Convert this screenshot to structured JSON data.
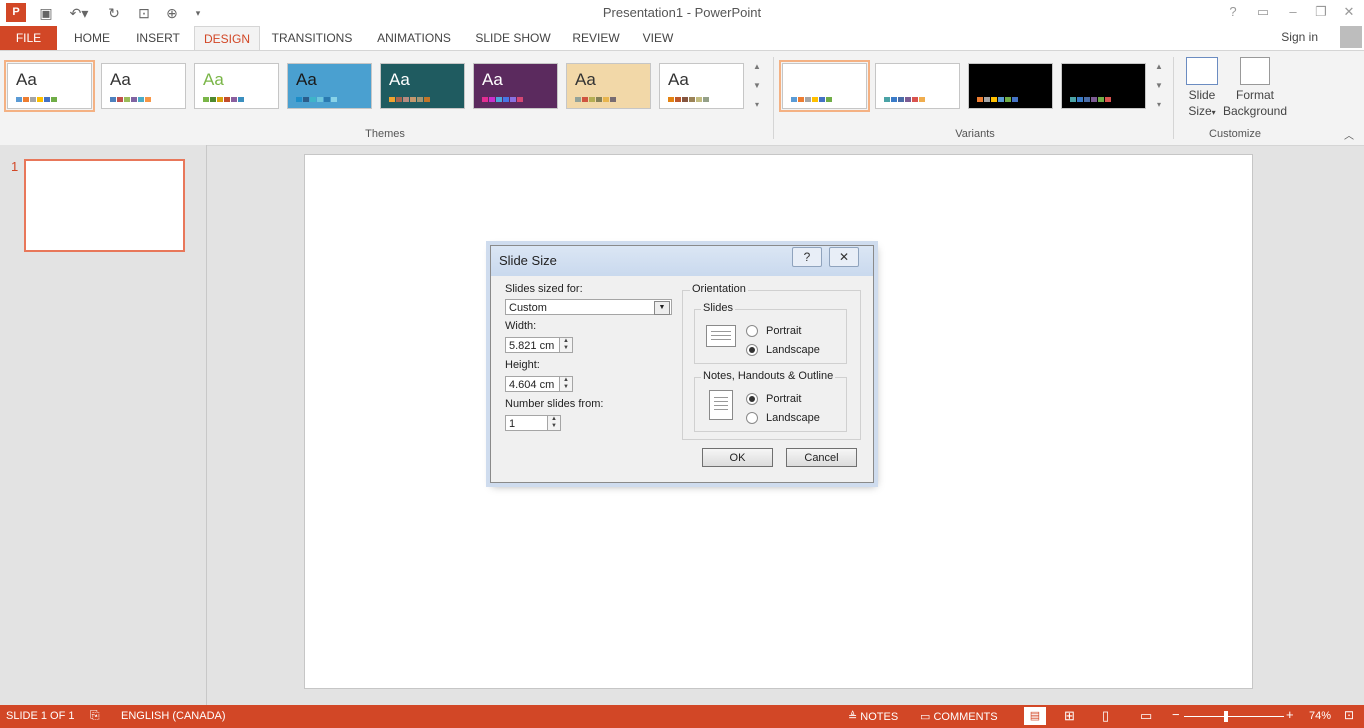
{
  "app": {
    "icon_text": "P",
    "window_title": "Presentation1 - PowerPoint",
    "quick_access": [
      "save-icon",
      "undo-icon",
      "redo-icon",
      "start-from-beginning-icon",
      "print-preview-icon",
      "customize-qat-icon"
    ],
    "window_controls": {
      "help": "?",
      "restore_ribbon": "▭",
      "minimize": "–",
      "maximize": "❐",
      "close": "✕"
    }
  },
  "tabs": [
    {
      "label": "FILE"
    },
    {
      "label": "HOME"
    },
    {
      "label": "INSERT"
    },
    {
      "label": "DESIGN",
      "selected": true
    },
    {
      "label": "TRANSITIONS"
    },
    {
      "label": "ANIMATIONS"
    },
    {
      "label": "SLIDE SHOW"
    },
    {
      "label": "REVIEW"
    },
    {
      "label": "VIEW"
    }
  ],
  "sign_in": "Sign in",
  "ribbon": {
    "themes_label": "Themes",
    "variants_label": "Variants",
    "customize_label": "Customize",
    "themes": [
      {
        "text": "Aa",
        "bg": "#ffffff",
        "text_color": "#333333",
        "swatches": [
          "#5b9bd5",
          "#ed7d31",
          "#a5a5a5",
          "#ffc000",
          "#4472c4",
          "#70ad47"
        ]
      },
      {
        "text": "Aa",
        "bg": "#ffffff",
        "text_color": "#333333",
        "swatches": [
          "#4f81bd",
          "#c0504d",
          "#9bbb59",
          "#8064a2",
          "#4bacc6",
          "#f79646"
        ]
      },
      {
        "text": "Aa",
        "bg": "#ffffff",
        "text_color": "#7ab648",
        "swatches": [
          "#7ab648",
          "#4f8a2e",
          "#d8a20d",
          "#c24d2c",
          "#8a5f9e",
          "#3b8fbf"
        ]
      },
      {
        "text": "Aa",
        "bg": "#4aa0d0",
        "text_color": "#1a1a1a",
        "swatches": [
          "#1d8dc8",
          "#2b5d8a",
          "#3fb4c9",
          "#6dc6dd",
          "#2a7ab0",
          "#88d3e8"
        ]
      },
      {
        "text": "Aa",
        "bg": "#1f5b60",
        "text_color": "#ffffff",
        "swatches": [
          "#f0a22e",
          "#a5644e",
          "#b58b80",
          "#c3986d",
          "#a19574",
          "#c17529"
        ]
      },
      {
        "text": "Aa",
        "bg": "#5b2a5e",
        "text_color": "#ffffff",
        "swatches": [
          "#e32d91",
          "#c830cc",
          "#4ea6dc",
          "#4775e7",
          "#8971e1",
          "#d54773"
        ]
      },
      {
        "text": "Aa",
        "bg": "#f2d8a8",
        "text_color": "#333333",
        "swatches": [
          "#93a299",
          "#cf543f",
          "#b5ae53",
          "#848058",
          "#e8b54d",
          "#786c71"
        ]
      },
      {
        "text": "Aa",
        "bg": "#ffffff",
        "text_color": "#333333",
        "swatches": [
          "#e48312",
          "#bd582c",
          "#865640",
          "#9b8357",
          "#c2bc80",
          "#94a088"
        ]
      }
    ],
    "variants": [
      {
        "bg": "#ffffff",
        "swatches": [
          "#5b9bd5",
          "#ed7d31",
          "#a5a5a5",
          "#ffc000",
          "#4472c4",
          "#70ad47"
        ]
      },
      {
        "bg": "#ffffff",
        "swatches": [
          "#4aa3a6",
          "#3a7bc8",
          "#4a6da7",
          "#7c5c93",
          "#d9534f",
          "#f0ad4e"
        ]
      },
      {
        "bg": "#000000",
        "swatches": [
          "#ed7d31",
          "#a5a5a5",
          "#ffc000",
          "#5b9bd5",
          "#70ad47",
          "#4472c4"
        ]
      },
      {
        "bg": "#000000",
        "swatches": [
          "#4aa3a6",
          "#3a7bc8",
          "#4a6da7",
          "#7c5c93",
          "#70ad47",
          "#d9534f"
        ]
      }
    ],
    "slide_size_label_1": "Slide",
    "slide_size_label_2": "Size",
    "format_bg_label_1": "Format",
    "format_bg_label_2": "Background"
  },
  "slides_pane": {
    "slide_number": "1"
  },
  "dialog": {
    "title": "Slide Size",
    "help_btn": "?",
    "close_btn": "✕",
    "sized_for_label": "Slides sized for:",
    "sized_for_value": "Custom",
    "width_label": "Width:",
    "width_value": "5.821 cm",
    "height_label": "Height:",
    "height_value": "4.604 cm",
    "number_from_label": "Number slides from:",
    "number_from_value": "1",
    "orientation_label": "Orientation",
    "slides_group_label": "Slides",
    "slides_portrait": "Portrait",
    "slides_landscape": "Landscape",
    "slides_selected": "Landscape",
    "notes_group_label": "Notes, Handouts & Outline",
    "notes_portrait": "Portrait",
    "notes_landscape": "Landscape",
    "notes_selected": "Portrait",
    "ok": "OK",
    "cancel": "Cancel"
  },
  "status": {
    "slide_info": "SLIDE 1 OF 1",
    "language": "ENGLISH (CANADA)",
    "notes": "NOTES",
    "comments": "COMMENTS",
    "zoom": "74%",
    "zoom_fraction": 0.42
  },
  "colors": {
    "accent": "#d24726",
    "dialog_title_bg": "#c9d9ee"
  }
}
